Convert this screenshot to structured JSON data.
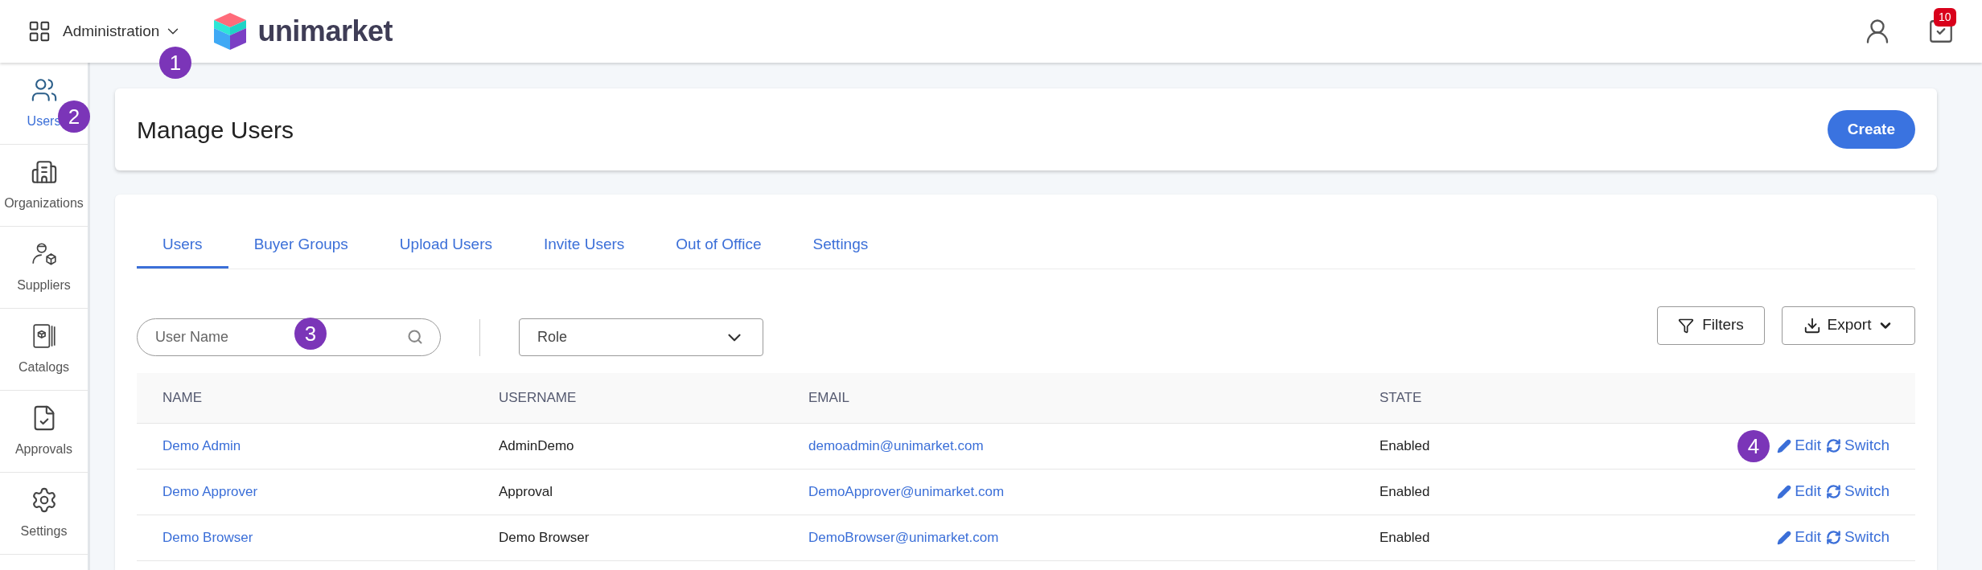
{
  "header": {
    "app_switcher": "Administration",
    "logo_text": "unimarket",
    "notification_count": "10"
  },
  "sidebar": {
    "items": [
      {
        "label": "Users",
        "kind": "users",
        "selected": true
      },
      {
        "label": "Organizations",
        "kind": "organizations",
        "selected": false
      },
      {
        "label": "Suppliers",
        "kind": "suppliers",
        "selected": false
      },
      {
        "label": "Catalogs",
        "kind": "catalogs",
        "selected": false
      },
      {
        "label": "Approvals",
        "kind": "approvals",
        "selected": false
      },
      {
        "label": "Settings",
        "kind": "settings",
        "selected": false
      }
    ]
  },
  "page_header": {
    "title": "Manage Users",
    "create_button": "Create"
  },
  "tabs": [
    {
      "label": "Users",
      "selected": true
    },
    {
      "label": "Buyer Groups",
      "selected": false
    },
    {
      "label": "Upload Users",
      "selected": false
    },
    {
      "label": "Invite Users",
      "selected": false
    },
    {
      "label": "Out of Office",
      "selected": false
    },
    {
      "label": "Settings",
      "selected": false
    }
  ],
  "filters": {
    "search_placeholder": "User Name",
    "role_placeholder": "Role",
    "filters_button": "Filters",
    "export_button": "Export"
  },
  "table": {
    "columns": [
      "NAME",
      "USERNAME",
      "EMAIL",
      "STATE"
    ],
    "rows": [
      {
        "name": "Demo Admin",
        "username": "AdminDemo",
        "email": "demoadmin@unimarket.com",
        "state": "Enabled",
        "edit": "Edit",
        "switch": "Switch"
      },
      {
        "name": "Demo Approver",
        "username": "Approval",
        "email": "DemoApprover@unimarket.com",
        "state": "Enabled",
        "edit": "Edit",
        "switch": "Switch"
      },
      {
        "name": "Demo Browser",
        "username": "Demo Browser",
        "email": "DemoBrowser@unimarket.com",
        "state": "Enabled",
        "edit": "Edit",
        "switch": "Switch"
      }
    ]
  },
  "callouts": [
    "1",
    "2",
    "3",
    "4"
  ]
}
